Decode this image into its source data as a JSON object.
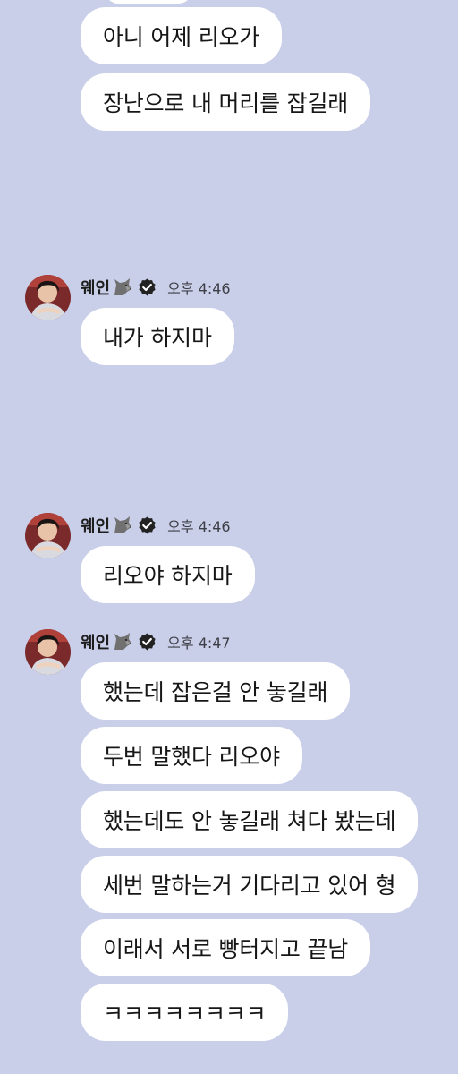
{
  "colors": {
    "background": "#c9cfe9",
    "bubble": "#ffffff",
    "text": "#161616",
    "badge": "#222222"
  },
  "icons": {
    "wolf": "wolf-emoji-icon",
    "verified": "verified-check-icon",
    "avatar": "profile-photo"
  },
  "messages_top": [
    {
      "text": "아니 어제 리오가"
    },
    {
      "text": "장난으로 내 머리를 잡길래"
    }
  ],
  "groups": [
    {
      "sender": "웨인",
      "time": "오후 4:46",
      "messages": [
        {
          "text": "내가 하지마"
        }
      ]
    },
    {
      "sender": "웨인",
      "time": "오후 4:46",
      "messages": [
        {
          "text": "리오야 하지마"
        }
      ]
    },
    {
      "sender": "웨인",
      "time": "오후 4:47",
      "messages": [
        {
          "text": "했는데 잡은걸 안 놓길래"
        },
        {
          "text": "두번 말했다 리오야"
        },
        {
          "text": "했는데도 안 놓길래 쳐다 봤는데"
        },
        {
          "text": "세번 말하는거 기다리고 있어 형"
        },
        {
          "text": "이래서 서로 빵터지고 끝남"
        },
        {
          "text": "ㅋㅋㅋㅋㅋㅋㅋㅋ"
        }
      ]
    }
  ]
}
